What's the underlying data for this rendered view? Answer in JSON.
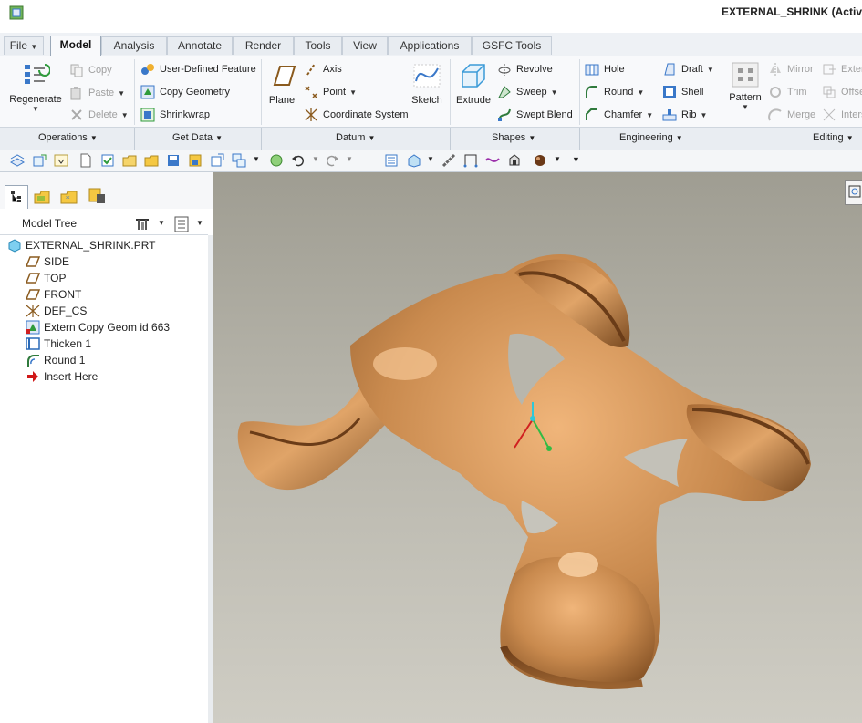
{
  "window": {
    "title": "EXTERNAL_SHRINK (Activ"
  },
  "tabs": [
    {
      "label": "File",
      "dropdown": true
    },
    {
      "label": "Model",
      "active": true
    },
    {
      "label": "Analysis"
    },
    {
      "label": "Annotate"
    },
    {
      "label": "Render"
    },
    {
      "label": "Tools"
    },
    {
      "label": "View"
    },
    {
      "label": "Applications"
    },
    {
      "label": "GSFC Tools"
    }
  ],
  "ribbon": {
    "operations": {
      "regenerate": "Regenerate",
      "copy": "Copy",
      "paste": "Paste",
      "delete": "Delete"
    },
    "get_data": {
      "user_defined_feature": "User-Defined Feature",
      "copy_geometry": "Copy Geometry",
      "shrinkwrap": "Shrinkwrap"
    },
    "datum": {
      "plane": "Plane",
      "axis": "Axis",
      "point": "Point",
      "coordinate_system": "Coordinate System",
      "sketch": "Sketch"
    },
    "shapes": {
      "extrude": "Extrude",
      "revolve": "Revolve",
      "sweep": "Sweep",
      "swept_blend": "Swept Blend"
    },
    "engineering": {
      "hole": "Hole",
      "round": "Round",
      "chamfer": "Chamfer",
      "draft": "Draft",
      "shell": "Shell",
      "rib": "Rib"
    },
    "editing": {
      "pattern": "Pattern",
      "mirror": "Mirror",
      "trim": "Trim",
      "merge": "Merge",
      "extend": "Exten",
      "offset": "Offse",
      "intersect": "Inters"
    },
    "groups": {
      "operations": "Operations",
      "get_data": "Get Data",
      "datum": "Datum",
      "shapes": "Shapes",
      "engineering": "Engineering",
      "editing": "Editing"
    }
  },
  "model_tree": {
    "header": "Model Tree",
    "items": [
      {
        "label": "EXTERNAL_SHRINK.PRT",
        "icon": "part-icon"
      },
      {
        "label": "SIDE",
        "icon": "datum-plane-icon"
      },
      {
        "label": "TOP",
        "icon": "datum-plane-icon"
      },
      {
        "label": "FRONT",
        "icon": "datum-plane-icon"
      },
      {
        "label": "DEF_CS",
        "icon": "coordinate-system-icon"
      },
      {
        "label": "Extern Copy Geom id 663",
        "icon": "copy-geometry-icon"
      },
      {
        "label": "Thicken 1",
        "icon": "thicken-icon"
      },
      {
        "label": "Round 1",
        "icon": "round-icon"
      },
      {
        "label": "Insert Here",
        "icon": "insert-arrow-icon"
      }
    ]
  },
  "colors": {
    "model_copper": "#c98a4e",
    "viewport_top": "#9f9d92",
    "viewport_bottom": "#cfcdc4",
    "accent_blue": "#3a78c9"
  }
}
